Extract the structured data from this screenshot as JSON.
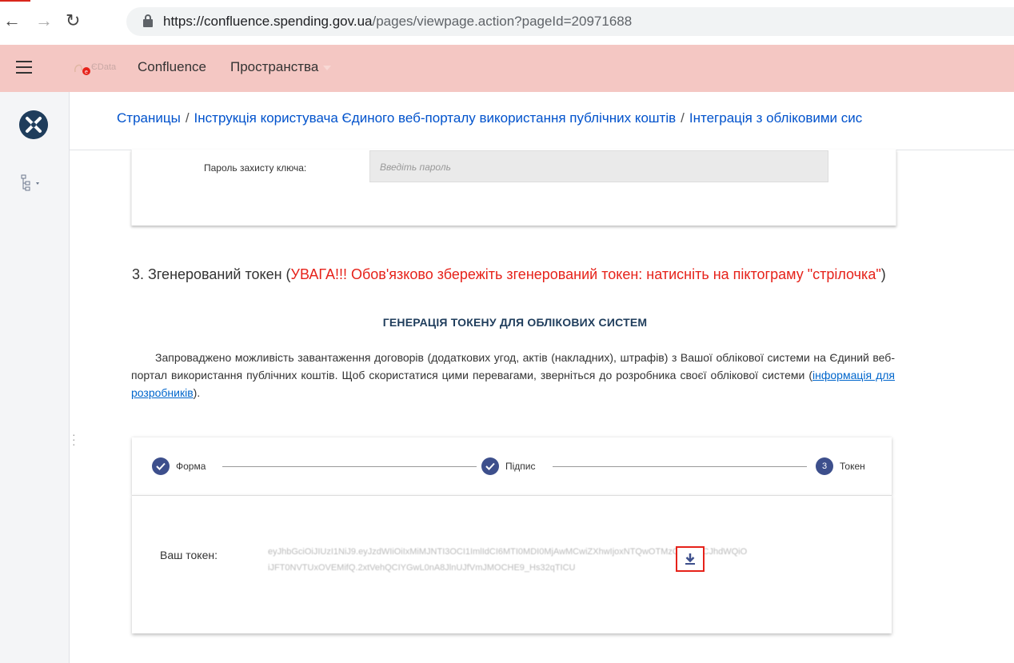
{
  "browser": {
    "url_host": "https://confluence.spending.gov.ua",
    "url_path": "/pages/viewpage.action?pageId=20971688"
  },
  "header": {
    "logo_text": "ЄData",
    "app_name": "Confluence",
    "spaces_label": "Пространства"
  },
  "breadcrumb": {
    "items": [
      "Страницы",
      "Інструкція користувача Єдиного веб-порталу використання публічних коштів",
      "Інтеграція з обліковими сис"
    ],
    "separator": "/"
  },
  "key_form": {
    "label": "Пароль захисту ключа:",
    "placeholder": "Введіть пароль"
  },
  "step3": {
    "prefix": "3. Згенерований токен (",
    "warning": "УВАГА!!! Обов'язково збережіть згенерований токен: натисніть на піктограму \"стрілочка\"",
    "suffix": ")"
  },
  "token_page": {
    "title": "ГЕНЕРАЦІЯ ТОКЕНУ ДЛЯ ОБЛІКОВИХ СИСТЕМ",
    "intro": "Запроваджено можливість завантаження договорів (додаткових угод, актів (накладних), штрафів) з Вашої облікової системи на Єдиний веб-портал використання публічних коштів. Щоб скористатися цими перевагами, зверніться до розробника своєї облікової системи (",
    "intro_link": "інформація для розробників",
    "intro_end": ").",
    "steps": [
      {
        "label": "Форма",
        "state": "done"
      },
      {
        "label": "Підпис",
        "state": "done"
      },
      {
        "label": "Токен",
        "number": "3",
        "state": "active"
      }
    ],
    "token_label": "Ваш токен:",
    "token_value": "eyJhbGciOiJIUzI1NiJ9.eyJzdWIiOiIxMiMJNTI3OCI1ImlIdCI6MTI0MDI0MjAwMCwiZXhwIjoxNTQwOTMzODAwLCJhdWQiOiJFT0NVTUxOVEMifQ.2xtVehQCIYGwL0nA8JlnUJfVmJMOCHE9_Hs32qTICU"
  },
  "colors": {
    "header_bg": "#f4c7c3",
    "link": "#0052cc",
    "warning": "#e6221a",
    "step_circle": "#3d4f8c"
  }
}
